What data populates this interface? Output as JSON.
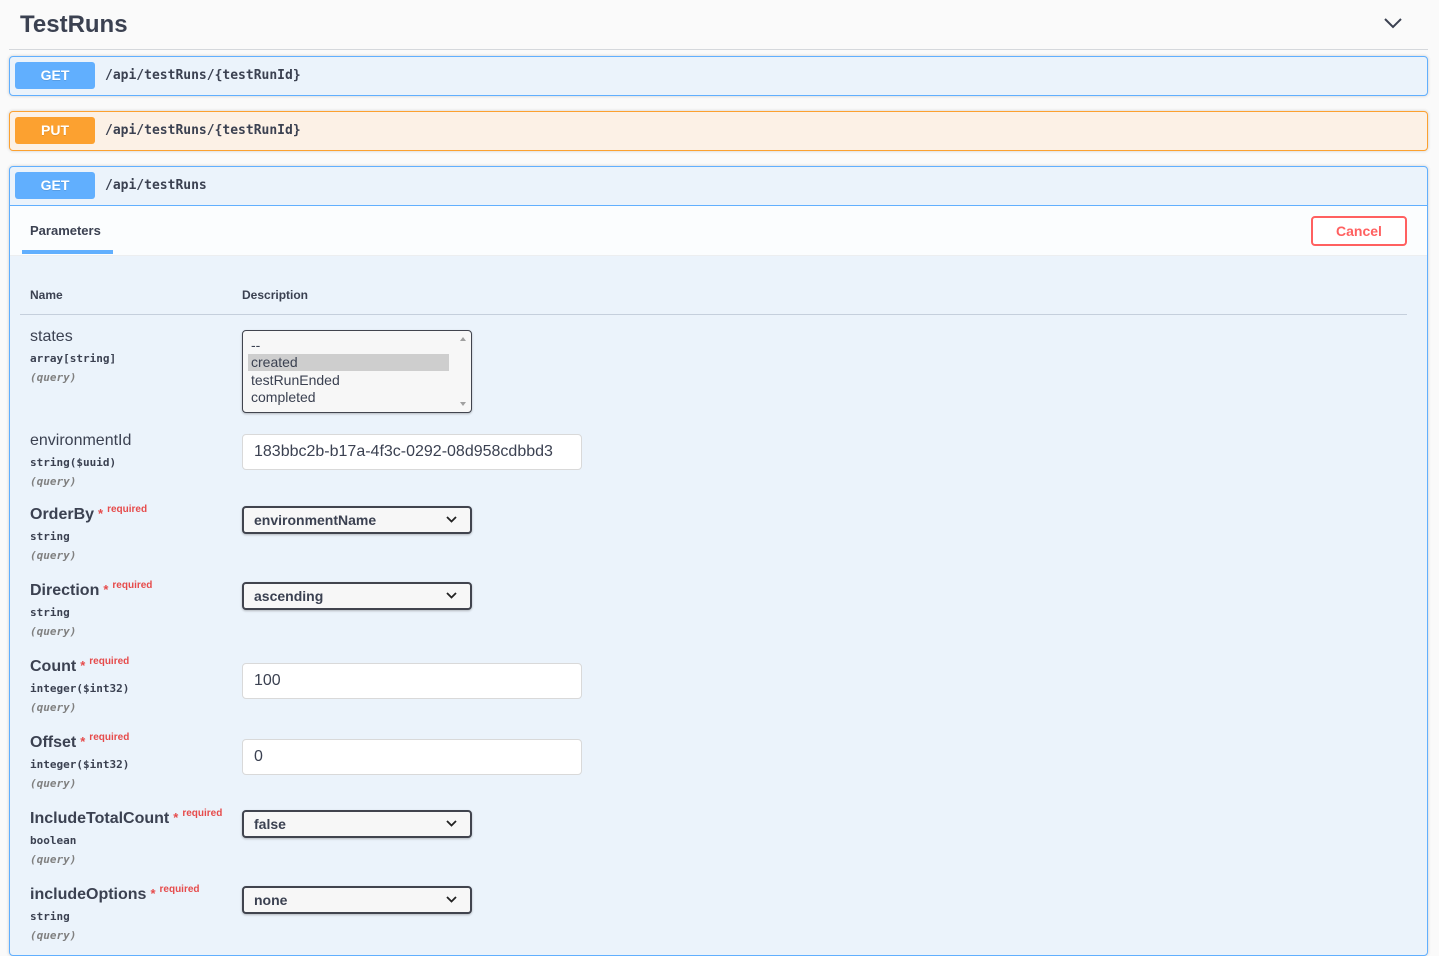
{
  "section": {
    "title": "TestRuns"
  },
  "operations": [
    {
      "method": "GET",
      "path": "/api/testRuns/{testRunId}"
    },
    {
      "method": "PUT",
      "path": "/api/testRuns/{testRunId}"
    },
    {
      "method": "GET",
      "path": "/api/testRuns"
    }
  ],
  "panel": {
    "tab_label": "Parameters",
    "cancel_label": "Cancel",
    "col_name": "Name",
    "col_description": "Description"
  },
  "params": {
    "states": {
      "name": "states",
      "type": "array[string]",
      "in": "(query)",
      "options": [
        "--",
        "created",
        "testRunEnded",
        "completed"
      ],
      "selected": "created"
    },
    "environmentId": {
      "name": "environmentId",
      "type": "string($uuid)",
      "in": "(query)",
      "value": "183bbc2b-b17a-4f3c-0292-08d958cdbbd3"
    },
    "orderBy": {
      "name": "OrderBy",
      "required_mark": "*",
      "required_text": "required",
      "type": "string",
      "in": "(query)",
      "value": "environmentName"
    },
    "direction": {
      "name": "Direction",
      "required_mark": "*",
      "required_text": "required",
      "type": "string",
      "in": "(query)",
      "value": "ascending"
    },
    "count": {
      "name": "Count",
      "required_mark": "*",
      "required_text": "required",
      "type": "integer($int32)",
      "in": "(query)",
      "value": "100"
    },
    "offset": {
      "name": "Offset",
      "required_mark": "*",
      "required_text": "required",
      "type": "integer($int32)",
      "in": "(query)",
      "value": "0"
    },
    "includeTotalCount": {
      "name": "IncludeTotalCount",
      "required_mark": "*",
      "required_text": "required",
      "type": "boolean",
      "in": "(query)",
      "value": "false"
    },
    "includeOptions": {
      "name": "includeOptions",
      "required_mark": "*",
      "required_text": "required",
      "type": "string",
      "in": "(query)",
      "value": "none"
    }
  },
  "colors": {
    "get": "#61affe",
    "put": "#fca130",
    "cancel": "#ff6060",
    "required": "#e64b4b"
  }
}
